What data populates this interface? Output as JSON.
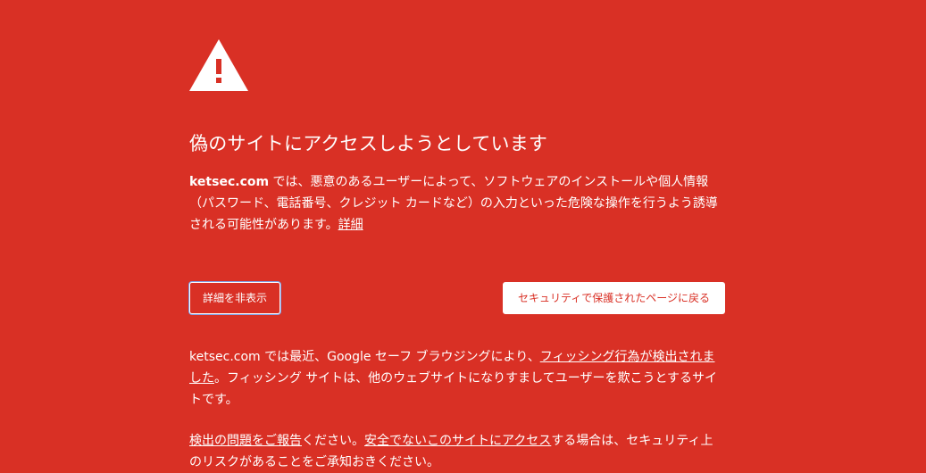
{
  "icons": {
    "warning": "warning-triangle-icon"
  },
  "colors": {
    "background": "#d93025",
    "text": "#ffffff",
    "focus_ring": "#7b9fe8"
  },
  "heading": "偽のサイトにアクセスしようとしています",
  "main_message": {
    "domain": "ketsec.com",
    "text": " では、悪意のあるユーザーによって、ソフトウェアのインストールや個人情報（パスワード、電話番号、クレジット カードなど）の入力といった危険な操作を行うよう誘導される可能性があります。",
    "details_link": "詳細"
  },
  "buttons": {
    "details": "詳細を非表示",
    "back_to_safety": "セキュリティで保護されたページに戻る"
  },
  "details": {
    "p1_prefix": "ketsec.com では最近、Google セーフ ブラウジングにより、",
    "p1_link": "フィッシング行為が検出されました",
    "p1_suffix": "。フィッシング サイトは、他のウェブサイトになりすましてユーザーを欺こうとするサイトです。",
    "p2_link1": "検出の問題をご報告",
    "p2_middle": "ください。",
    "p2_link2": "安全でないこのサイトにアクセス",
    "p2_suffix": "する場合は、セキュリティ上のリスクがあることをご承知おきください。"
  }
}
